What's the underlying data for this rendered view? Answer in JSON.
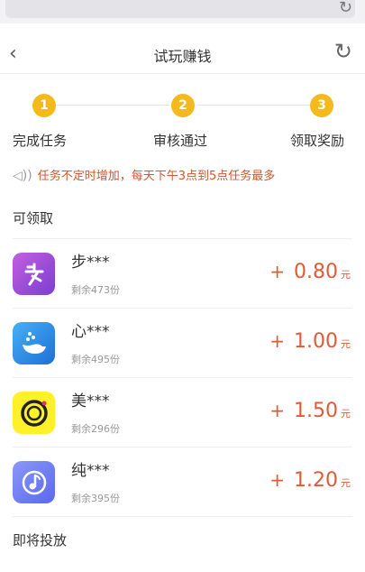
{
  "browser": {
    "reload_icon": "reload-icon"
  },
  "nav": {
    "title": "试玩赚钱",
    "back_icon": "chevron-left-icon",
    "refresh_icon": "refresh-icon"
  },
  "steps": [
    {
      "number": "1",
      "label": "完成任务"
    },
    {
      "number": "2",
      "label": "审核通过"
    },
    {
      "number": "3",
      "label": "领取奖励"
    }
  ],
  "notice": "任务不定时增加，每天下午3点到5点任务最多",
  "sections": {
    "available": "可领取",
    "upcoming": "即将投放"
  },
  "tasks": [
    {
      "name": "步***",
      "remaining": "剩余473份",
      "plus": "+",
      "amount": "0.80",
      "unit": "元",
      "icon_color": "#9a4fd6"
    },
    {
      "name": "心***",
      "remaining": "剩余495份",
      "plus": "+",
      "amount": "1.00",
      "unit": "元",
      "icon_color": "#2f8ee8"
    },
    {
      "name": "美***",
      "remaining": "剩余296份",
      "plus": "+",
      "amount": "1.50",
      "unit": "元",
      "icon_color": "#fff02a"
    },
    {
      "name": "纯***",
      "remaining": "剩余395份",
      "plus": "+",
      "amount": "1.20",
      "unit": "元",
      "icon_color": "#6b78f2"
    }
  ],
  "colors": {
    "accent": "#e05a37",
    "step": "#f4b91d"
  }
}
